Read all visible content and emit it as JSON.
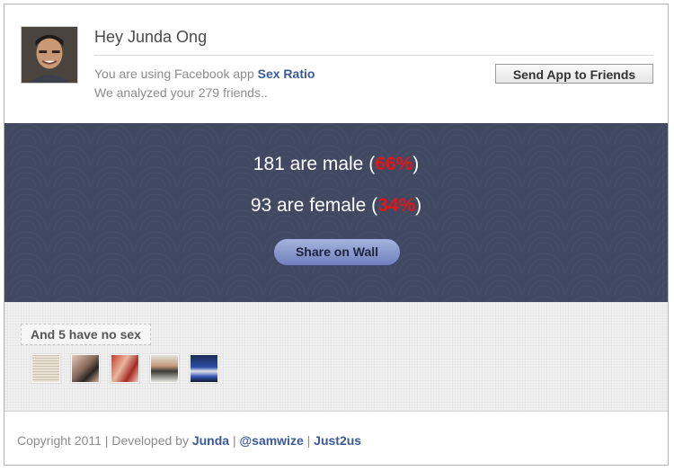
{
  "header": {
    "greeting": "Hey Junda Ong",
    "usage_prefix": "You are using Facebook app",
    "app_name": "Sex Ratio",
    "analyzed": "We analyzed your 279 friends..",
    "send_button": "Send App to Friends"
  },
  "results": {
    "male_prefix": "181 are male (",
    "male_pct": "66%",
    "male_suffix": ")",
    "female_prefix": "93 are female (",
    "female_pct": "34%",
    "female_suffix": ")",
    "share_button": "Share on Wall",
    "accent_color": "#e0161b"
  },
  "nosex": {
    "label": "And 5 have no sex",
    "thumb_count": 5
  },
  "footer": {
    "copyright": "Copyright 2011 | Developed by",
    "dev_link": "Junda",
    "sep1": "|",
    "twitter_link": "@samwize",
    "sep2": "|",
    "company_link": "Just2us",
    "link_color": "#3b5998"
  }
}
